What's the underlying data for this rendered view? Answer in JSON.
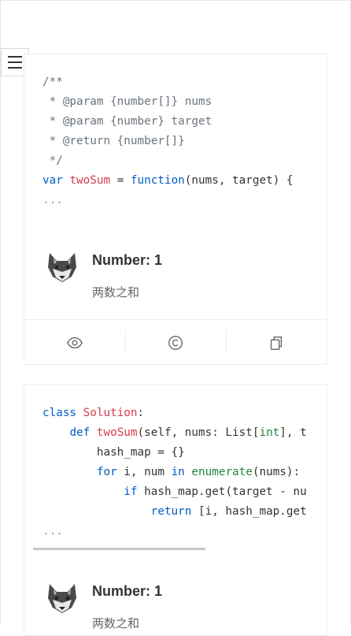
{
  "menu": {
    "icon": "hamburger-icon"
  },
  "cards": [
    {
      "language": "javascript",
      "title": "Number: 1",
      "subtitle": "两数之和",
      "avatar_icon": "wolf-avatar-icon",
      "actions": [
        "eye-icon",
        "copyright-icon",
        "copy-icon"
      ]
    },
    {
      "language": "python",
      "title": "Number: 1",
      "subtitle": "两数之和",
      "avatar_icon": "wolf-avatar-icon"
    }
  ],
  "code_js": {
    "l1": "/**",
    "l2": " * @param {number[]} nums",
    "l3": " * @param {number} target",
    "l4": " * @return {number[]}",
    "l5": " */",
    "l6_kw": "var",
    "l6_name": "twoSum",
    "l6_eq": " = ",
    "l6_fn": "function",
    "l6_rest": "(nums, target) {",
    "l7": "..."
  },
  "code_py": {
    "l1_kw": "class",
    "l1_name": "Solution",
    "l1_rest": ":",
    "l2_indent": "    ",
    "l2_kw": "def",
    "l2_name": "twoSum",
    "l2_a": "(self, nums: List[",
    "l2_b": "int",
    "l2_c": "], t",
    "l3": "        hash_map = {}",
    "l4_indent": "        ",
    "l4_kw": "for",
    "l4_a": " i, num ",
    "l4_in": "in",
    "l4_sp": " ",
    "l4_bi": "enumerate",
    "l4_b": "(nums):",
    "l5_indent": "            ",
    "l5_kw": "if",
    "l5_a": " hash_map.get(target - nu",
    "l6_indent": "                ",
    "l6_kw": "return",
    "l6_a": " [i, hash_map.get",
    "l7": "..."
  }
}
